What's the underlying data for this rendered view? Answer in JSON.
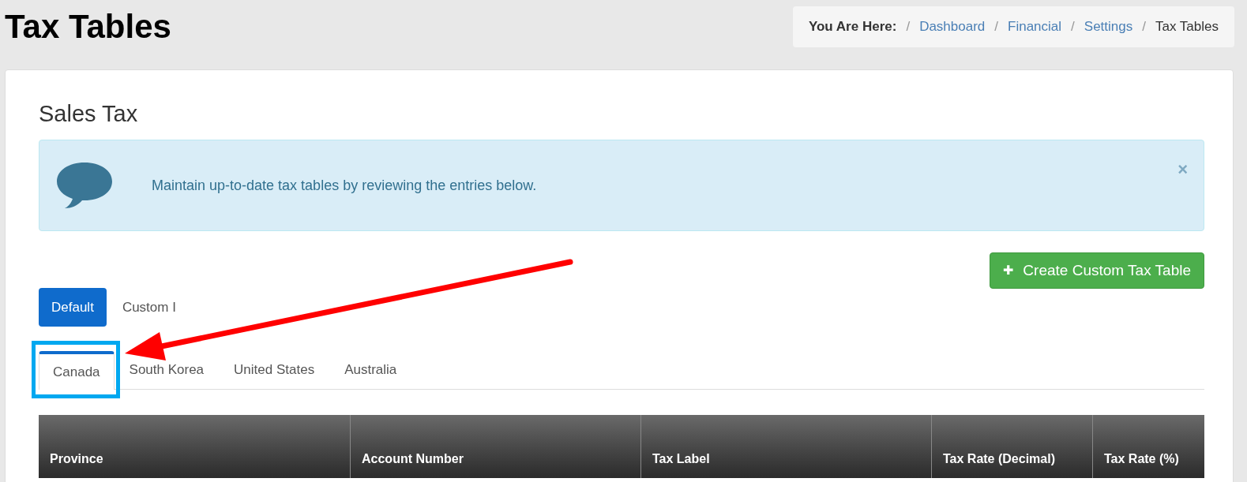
{
  "page_title": "Tax Tables",
  "breadcrumb": {
    "label": "You Are Here:",
    "separator": "/",
    "items": [
      {
        "text": "Dashboard",
        "kind": "link"
      },
      {
        "text": "Financial",
        "kind": "link"
      },
      {
        "text": "Settings",
        "kind": "link"
      },
      {
        "text": "Tax Tables",
        "kind": "current"
      }
    ]
  },
  "section_title": "Sales Tax",
  "alert": {
    "message": "Maintain up-to-date tax tables by reviewing the entries below.",
    "close": "×"
  },
  "create_button": {
    "icon": "✚",
    "label": "Create Custom Tax Table"
  },
  "table_tabs": [
    {
      "label": "Default",
      "selected": true
    },
    {
      "label": "Custom I",
      "selected": false
    }
  ],
  "country_tabs": [
    {
      "label": "Canada",
      "selected": true,
      "highlighted": true
    },
    {
      "label": "South Korea",
      "selected": false,
      "highlighted": false
    },
    {
      "label": "United States",
      "selected": false,
      "highlighted": false
    },
    {
      "label": "Australia",
      "selected": false,
      "highlighted": false
    }
  ],
  "table": {
    "columns": [
      "Province",
      "Account Number",
      "Tax Label",
      "Tax Rate (Decimal)",
      "Tax Rate (%)"
    ]
  }
}
